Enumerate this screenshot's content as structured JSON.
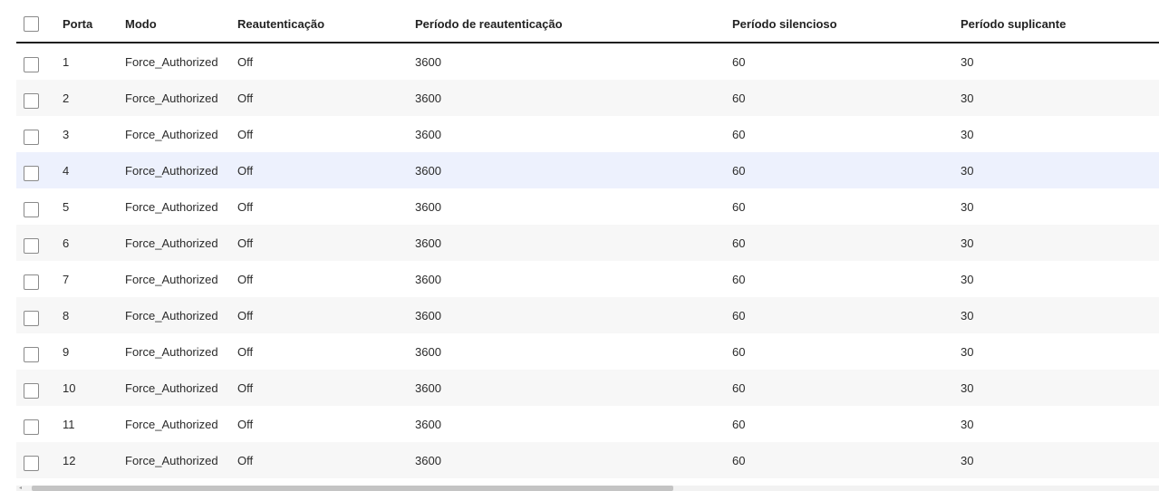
{
  "table": {
    "headers": {
      "port": "Porta",
      "mode": "Modo",
      "reauth": "Reautenticação",
      "reauth_period": "Período de reautenticação",
      "quiet_period": "Período silencioso",
      "supplicant_period": "Período suplicante"
    },
    "rows": [
      {
        "port": "1",
        "mode": "Force_Authorized",
        "reauth": "Off",
        "reauth_period": "3600",
        "quiet_period": "60",
        "supplicant_period": "30"
      },
      {
        "port": "2",
        "mode": "Force_Authorized",
        "reauth": "Off",
        "reauth_period": "3600",
        "quiet_period": "60",
        "supplicant_period": "30"
      },
      {
        "port": "3",
        "mode": "Force_Authorized",
        "reauth": "Off",
        "reauth_period": "3600",
        "quiet_period": "60",
        "supplicant_period": "30"
      },
      {
        "port": "4",
        "mode": "Force_Authorized",
        "reauth": "Off",
        "reauth_period": "3600",
        "quiet_period": "60",
        "supplicant_period": "30"
      },
      {
        "port": "5",
        "mode": "Force_Authorized",
        "reauth": "Off",
        "reauth_period": "3600",
        "quiet_period": "60",
        "supplicant_period": "30"
      },
      {
        "port": "6",
        "mode": "Force_Authorized",
        "reauth": "Off",
        "reauth_period": "3600",
        "quiet_period": "60",
        "supplicant_period": "30"
      },
      {
        "port": "7",
        "mode": "Force_Authorized",
        "reauth": "Off",
        "reauth_period": "3600",
        "quiet_period": "60",
        "supplicant_period": "30"
      },
      {
        "port": "8",
        "mode": "Force_Authorized",
        "reauth": "Off",
        "reauth_period": "3600",
        "quiet_period": "60",
        "supplicant_period": "30"
      },
      {
        "port": "9",
        "mode": "Force_Authorized",
        "reauth": "Off",
        "reauth_period": "3600",
        "quiet_period": "60",
        "supplicant_period": "30"
      },
      {
        "port": "10",
        "mode": "Force_Authorized",
        "reauth": "Off",
        "reauth_period": "3600",
        "quiet_period": "60",
        "supplicant_period": "30"
      },
      {
        "port": "11",
        "mode": "Force_Authorized",
        "reauth": "Off",
        "reauth_period": "3600",
        "quiet_period": "60",
        "supplicant_period": "30"
      },
      {
        "port": "12",
        "mode": "Force_Authorized",
        "reauth": "Off",
        "reauth_period": "3600",
        "quiet_period": "60",
        "supplicant_period": "30"
      }
    ]
  },
  "colors": {
    "row_alt": "#f7f7f7",
    "row_hover": "#edf1fd",
    "header_border": "#1f1f1f"
  }
}
